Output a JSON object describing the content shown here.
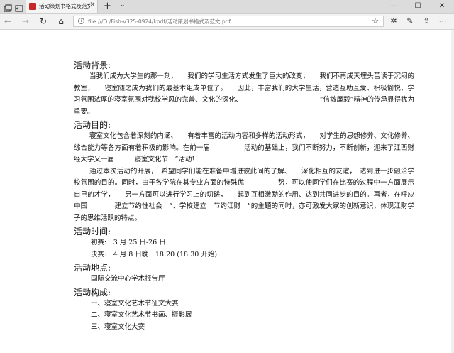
{
  "browser": {
    "tab_title": "活动策划书格式及范文.p",
    "address": "file:///D:/Fish-v325-0924/kpdf/活动策划书格式及范文.pdf",
    "icons": {
      "tab_actions": "tab-actions-icon",
      "tab_set_aside": "tab-set-aside-icon",
      "favicon": "pdf-icon",
      "close": "close-icon",
      "new_tab": "plus-icon",
      "back": "back-arrow-icon",
      "forward": "forward-arrow-icon",
      "refresh": "refresh-icon",
      "home": "home-icon",
      "info": "info-icon",
      "favorite": "star-icon",
      "favorites_bar": "favorites-icon",
      "notes": "pen-icon",
      "share": "share-icon",
      "more": "more-icon"
    }
  },
  "document": {
    "sections": [
      {
        "heading": "活动背景:",
        "paragraphs": [
          "当我们成为大学生的那一刻，　　我们的学习生活方式发生了巨大的改变，　　我们不再成天埋头苦读于沉闷的教室，　　寝室随之成为我们的最基本组成单位了。　　因此，丰富我们的大学生活，营造互助互爱、积极愉悦、学习氛围浓厚的寝室氛围对我校学风的完善、文化的深化、　　　　　　　　　　　　”信敏廉毅”精神的传承显得犹为重要。"
        ]
      },
      {
        "heading": "活动目的:",
        "paragraphs": [
          "寝室文化包含着深刻的内涵、　　有着丰富的活动内容和多样的活动形式，　　对学生的思想修养、文化修养、综合能力等各方面有着积极的影响。在前一届　　　　　活动的基础上，我们不断努力，不断创新，迎来了江西财经大学又一届　　　寝室文化节　”活动!",
          "通过本次活动的开展，　希望同学们能在准备中增进彼此间的了解、　　深化相互的友谊，　达到进一步融洽学校氛围的目的。同时，由于各学院在其专业方面的特殊优　　　　　势，可以使同学们在比赛的过程中一方面展示自己的才学，　　另一方面可以进行学习上的切磋，　　起到互相激励的作用、达到共同进步的目的。再者，在呼应中国　　　　建立节约性社会　”、学校建立　节约江财　”的主题的同时，亦可激发大家的创新意识，体现江财学子的思维活跃的特点。"
        ]
      },
      {
        "heading": "活动时间:",
        "items": [
          "初赛:　3 月 25 日-26 日",
          "决赛:　4 月 8 日晚　18:20 (18:30 开始)"
        ]
      },
      {
        "heading": "活动地点:",
        "items": [
          "国际交流中心学术报告厅"
        ]
      },
      {
        "heading": "活动构成:",
        "items": [
          "一、寝室文化艺术节征文大赛",
          "二、寝室文化艺术节书画、摄影展",
          "三、寝室文化大赛"
        ]
      }
    ]
  }
}
